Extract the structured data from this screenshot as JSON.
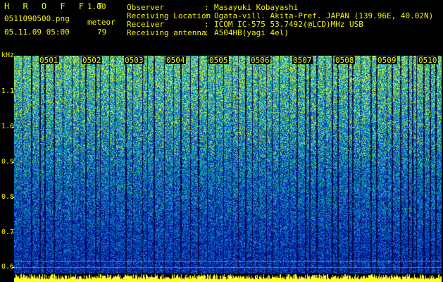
{
  "header": {
    "title": "H R O F F T",
    "version": "1.00",
    "filename": "0511090500.png",
    "datetime": "05.11.09 05:00",
    "meteor_label": "meteor",
    "meteor_count": "79",
    "info": [
      {
        "label": "Observer",
        "value": "Masayuki Kobayashi"
      },
      {
        "label": "Receiving Location",
        "value": "Ogata-vill. Akita-Pref. JAPAN (139.96E, 40.02N)"
      },
      {
        "label": "Receiver",
        "value": "ICOM IC-575 53.7492(@LCD)MHz USB"
      },
      {
        "label": "Receiving antenna",
        "value": "A504HB(yagi 4el)"
      }
    ]
  },
  "axis": {
    "unit": "kHz",
    "yticks": [
      "1.1",
      "1.0",
      "0.9",
      "0.8",
      "0.7",
      "0.6"
    ],
    "xticks": [
      "0501",
      "0502",
      "0503",
      "0504",
      "0505",
      "0506",
      "0507",
      "0508",
      "0509",
      "0510"
    ]
  },
  "colors": {
    "text": "#f4f400",
    "background": "#000000",
    "spectrum_high": "#33cc99",
    "spectrum_low": "#000a8a"
  }
}
